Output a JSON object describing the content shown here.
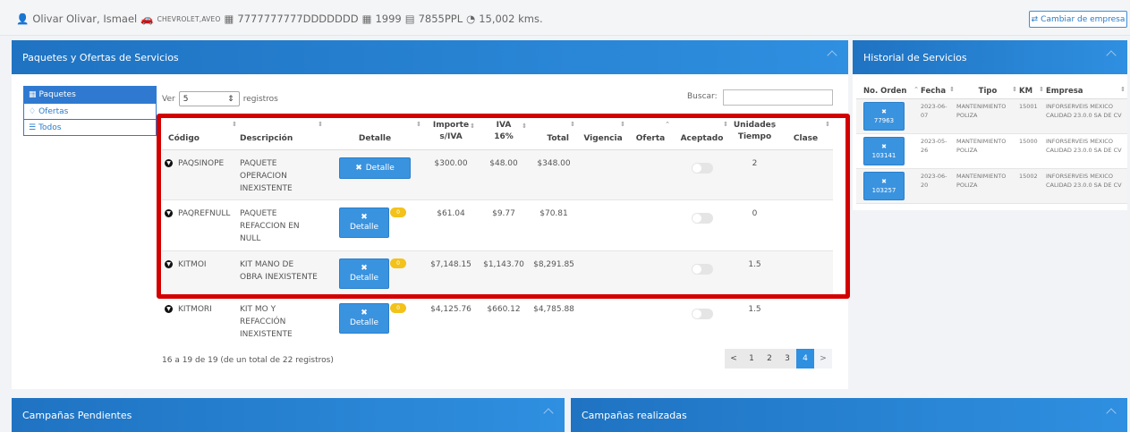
{
  "header": {
    "client": "Olivar Olivar, Ismael",
    "make_model": "CHEVROLET,AVEO",
    "vin": "7777777777DDDDDDD",
    "year": "1999",
    "plate": "7855PPL",
    "km": "15,002 kms.",
    "change_company": "Cambiar de empresa"
  },
  "packages_panel": {
    "title": "Paquetes y Ofertas de Servicios",
    "tabs": [
      "Paquetes",
      "Ofertas",
      "Todos"
    ],
    "ver_label": "Ver",
    "ver_value": "5",
    "registros_label": "registros",
    "buscar_label": "Buscar:",
    "columns": {
      "codigo": "Código",
      "descripcion": "Descripción",
      "detalle": "Detalle",
      "importe_1": "Importe",
      "importe_2": "s/IVA",
      "iva_1": "IVA",
      "iva_2": "16%",
      "total": "Total",
      "vigencia": "Vigencia",
      "oferta": "Oferta",
      "aceptado": "Aceptado",
      "unidades_1": "Unidades",
      "unidades_2": "Tiempo",
      "clase": "Clase"
    },
    "rows": [
      {
        "codigo": "PAQSINOPE",
        "desc1": "PAQUETE",
        "desc2": "OPERACION",
        "desc3": "INEXISTENTE",
        "detalle": "Detalle",
        "importe": "$300.00",
        "iva": "$48.00",
        "total": "$348.00",
        "unidades": "2"
      },
      {
        "codigo": "PAQREFNULL",
        "desc1": "PAQUETE",
        "desc2": "REFACCION EN",
        "desc3": "NULL",
        "detalle": "Detalle",
        "badge": "0",
        "importe": "$61.04",
        "iva": "$9.77",
        "total": "$70.81",
        "unidades": "0"
      },
      {
        "codigo": "KITMOI",
        "desc1": "KIT MANO DE",
        "desc2": "OBRA INEXISTENTE",
        "desc3": "",
        "detalle": "Detalle",
        "badge": "0",
        "importe": "$7,148.15",
        "iva": "$1,143.70",
        "total": "$8,291.85",
        "unidades": "1.5"
      },
      {
        "codigo": "KITMORI",
        "desc1": "KIT MO Y",
        "desc2": "REFACCIÓN",
        "desc3": "INEXISTENTE",
        "detalle": "Detalle",
        "badge": "0",
        "importe": "$4,125.76",
        "iva": "$660.12",
        "total": "$4,785.88",
        "unidades": "1.5"
      }
    ],
    "info": "16 a 19 de 19 (de un total de 22 registros)",
    "pager": [
      "<",
      "1",
      "2",
      "3",
      "4",
      ">"
    ]
  },
  "history_panel": {
    "title": "Historial de Servicios",
    "columns": [
      "No. Orden",
      "Fecha",
      "Tipo",
      "KM",
      "Empresa"
    ],
    "rows": [
      {
        "orden": "77963",
        "fecha1": "2023-06-",
        "fecha2": "07",
        "tipo1": "MANTENIMIENTO",
        "tipo2": "POLIZA",
        "km": "15001",
        "emp1": "INFORSERVEIS MEXICO",
        "emp2": "CALIDAD 23.0.0 SA DE CV"
      },
      {
        "orden": "103141",
        "fecha1": "2023-05-",
        "fecha2": "26",
        "tipo1": "MANTENIMIENTO",
        "tipo2": "POLIZA",
        "km": "15000",
        "emp1": "INFORSERVEIS MEXICO",
        "emp2": "CALIDAD 23.0.0 SA DE CV"
      },
      {
        "orden": "103257",
        "fecha1": "2023-06-",
        "fecha2": "20",
        "tipo1": "MANTENIMIENTO",
        "tipo2": "POLIZA",
        "km": "15002",
        "emp1": "INFORSERVEIS MEXICO",
        "emp2": "CALIDAD 23.0.0 SA DE CV"
      }
    ]
  },
  "bottom_panels": {
    "pending": "Campañas Pendientes",
    "done": "Campañas realizadas"
  },
  "colors": {
    "header_blue": "#2f8fe0",
    "button_blue": "#3a93df",
    "highlight_red": "#d40000",
    "badge_yellow": "#f3c21b"
  }
}
